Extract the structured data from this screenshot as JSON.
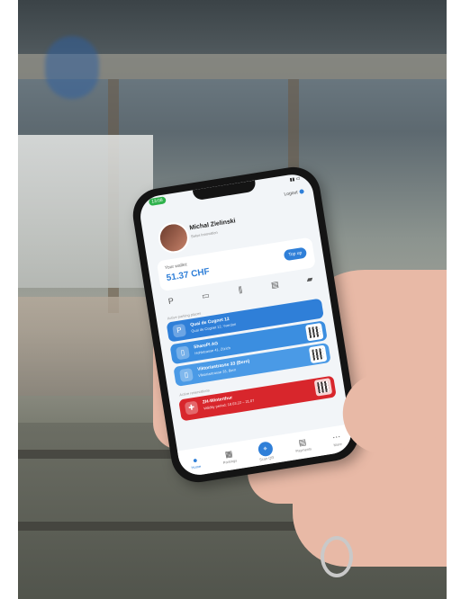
{
  "phone": {
    "status_time": "13:08",
    "logout": "Logout",
    "user_name": "Michal Zielinski",
    "user_sub": "Swiss Innovation",
    "wallet_label": "Your wallet:",
    "wallet_amount": "51.37 CHF",
    "topup_label": "Top up",
    "section_addresses": "Active parking places",
    "section_tickets": "Active reservations",
    "addresses": [
      {
        "title": "Quai de Cugnet 12",
        "sub": "Quai de Cugnet 12, Yverdon"
      },
      {
        "title": "SharePI AG",
        "sub": "Hohlstrasse 41, Zürich"
      },
      {
        "title": "Viktoriastrasse 33 (Bern)",
        "sub": "Viktoriastrasse 33, Bern"
      }
    ],
    "ticket": {
      "title": "ZH-Winterthur",
      "sub": "Validity period: 18.03.22 – 21.07"
    },
    "tabs": [
      "Home",
      "Parkings",
      "Scan QR",
      "Payments",
      "More"
    ]
  },
  "colors": {
    "accent": "#2f7fd8",
    "sbb_red": "#d8262c"
  }
}
